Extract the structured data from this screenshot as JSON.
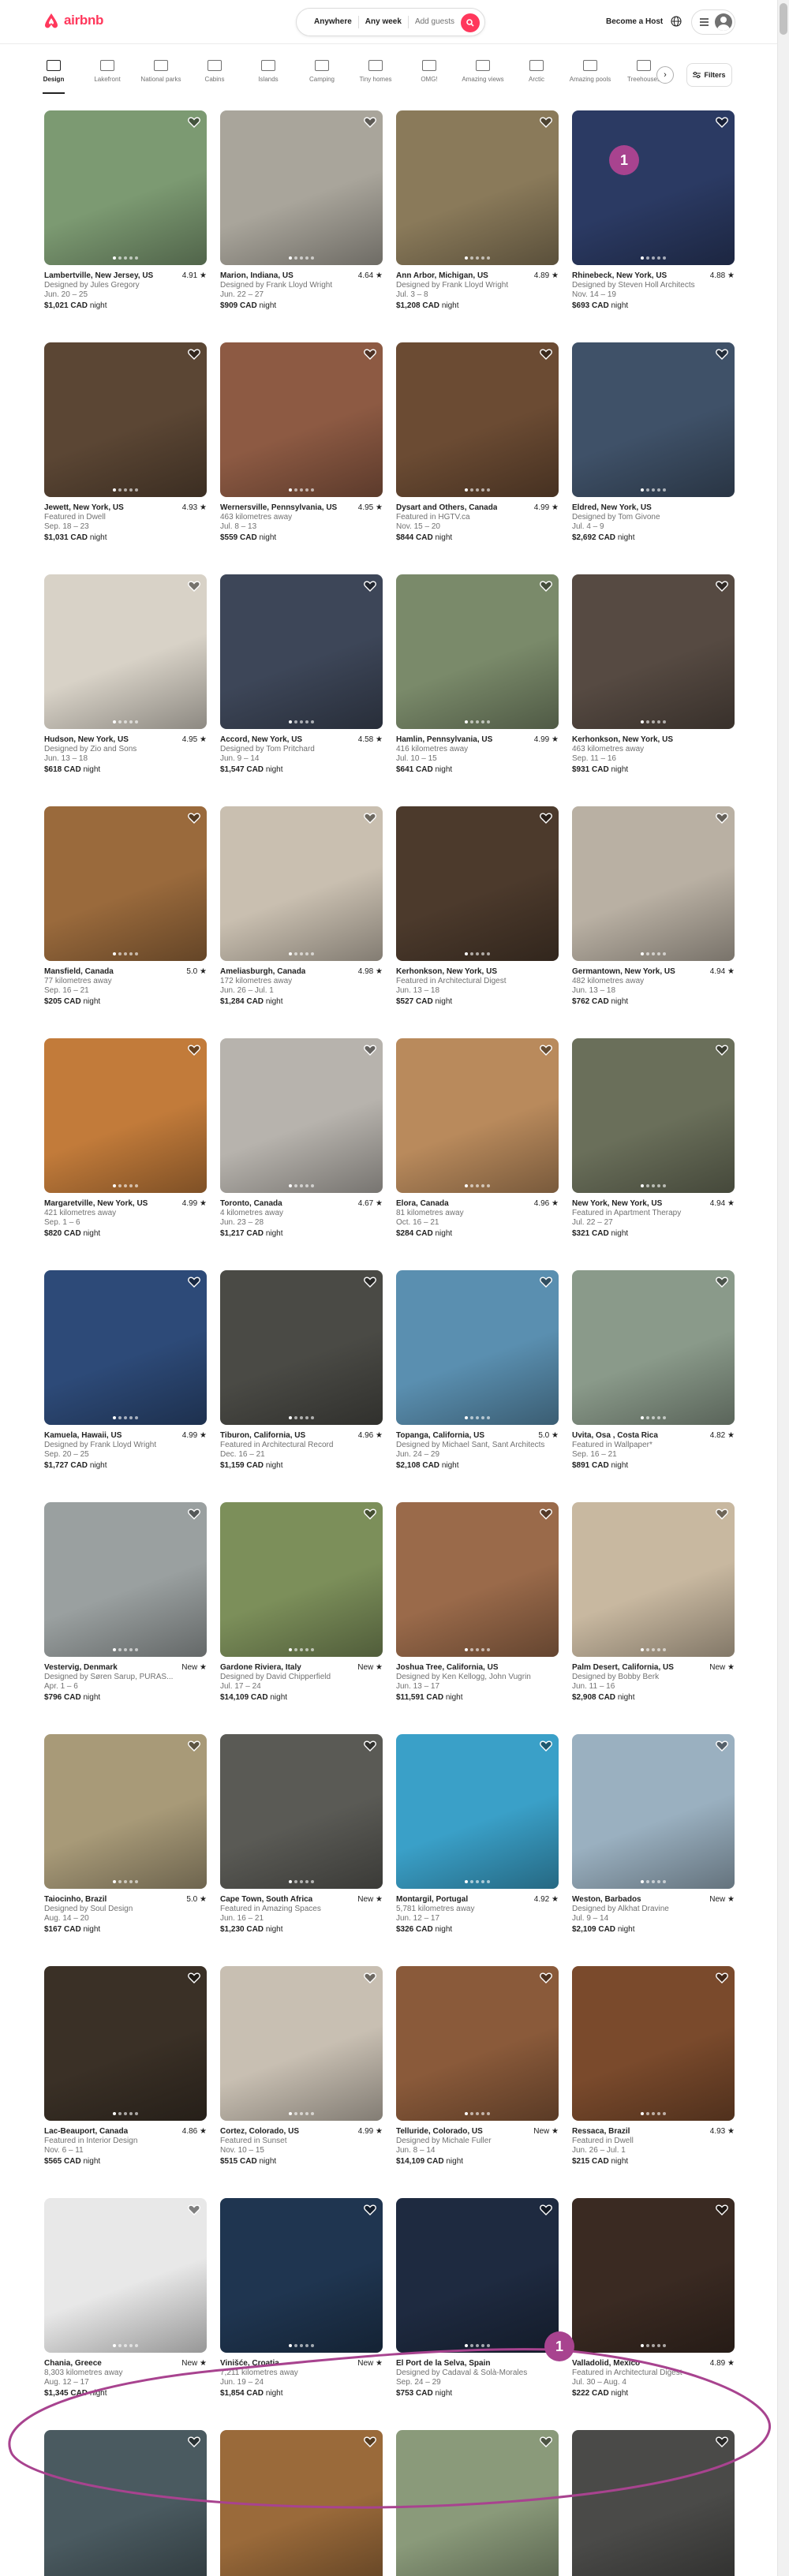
{
  "brand": {
    "name": "airbnb",
    "color": "#ff385c"
  },
  "search": {
    "anywhere": "Anywhere",
    "any_week": "Any week",
    "add_guests": "Add guests"
  },
  "header": {
    "become_host": "Become a Host"
  },
  "categories": [
    {
      "label": "Design",
      "icon": "design-icon",
      "active": true
    },
    {
      "label": "Lakefront",
      "icon": "lakefront-icon"
    },
    {
      "label": "National parks",
      "icon": "national-parks-icon"
    },
    {
      "label": "Cabins",
      "icon": "cabins-icon"
    },
    {
      "label": "Islands",
      "icon": "islands-icon"
    },
    {
      "label": "Camping",
      "icon": "camping-icon"
    },
    {
      "label": "Tiny homes",
      "icon": "tiny-homes-icon"
    },
    {
      "label": "OMG!",
      "icon": "omg-icon"
    },
    {
      "label": "Amazing views",
      "icon": "amazing-views-icon"
    },
    {
      "label": "Arctic",
      "icon": "arctic-icon"
    },
    {
      "label": "Amazing pools",
      "icon": "amazing-pools-icon"
    },
    {
      "label": "Treehouses",
      "icon": "treehouses-icon"
    }
  ],
  "filters_label": "Filters",
  "annotations": [
    "1",
    "1"
  ],
  "listings": [
    {
      "location": "Lambertville, New Jersey, US",
      "rating": "4.91 ★",
      "line2": "Designed by Jules Gregory",
      "dates": "Jun. 20 – 25",
      "price": "$1,021 CAD",
      "unit": "night",
      "color": "#7c9a72"
    },
    {
      "location": "Marion, Indiana, US",
      "rating": "4.64 ★",
      "line2": "Designed by Frank Lloyd Wright",
      "dates": "Jun. 22 – 27",
      "price": "$909 CAD",
      "unit": "night",
      "color": "#a9a59b"
    },
    {
      "location": "Ann Arbor, Michigan, US",
      "rating": "4.89 ★",
      "line2": "Designed by Frank Lloyd Wright",
      "dates": "Jul. 3 – 8",
      "price": "$1,208 CAD",
      "unit": "night",
      "color": "#8a7a5a"
    },
    {
      "location": "Rhinebeck, New York, US",
      "rating": "4.88 ★",
      "line2": "Designed by Steven Holl Architects",
      "dates": "Nov. 14 – 19",
      "price": "$693 CAD",
      "unit": "night",
      "color": "#2b3a63"
    },
    {
      "location": "Jewett, New York, US",
      "rating": "4.93 ★",
      "line2": "Featured in Dwell",
      "dates": "Sep. 18 – 23",
      "price": "$1,031 CAD",
      "unit": "night",
      "color": "#5b4634"
    },
    {
      "location": "Wernersville, Pennsylvania, US",
      "rating": "4.95 ★",
      "line2": "463 kilometres away",
      "dates": "Jul. 8 – 13",
      "price": "$559 CAD",
      "unit": "night",
      "color": "#8d5a43"
    },
    {
      "location": "Dysart and Others, Canada",
      "rating": "4.99 ★",
      "line2": "Featured in HGTV.ca",
      "dates": "Nov. 15 – 20",
      "price": "$844 CAD",
      "unit": "night",
      "color": "#6b4b33"
    },
    {
      "location": "Eldred, New York, US",
      "rating": "",
      "line2": "Designed by Tom Givone",
      "dates": "Jul. 4 – 9",
      "price": "$2,692 CAD",
      "unit": "night",
      "color": "#3f5168"
    },
    {
      "location": "Hudson, New York, US",
      "rating": "4.95 ★",
      "line2": "Designed by Zio and Sons",
      "dates": "Jun. 13 – 18",
      "price": "$618 CAD",
      "unit": "night",
      "color": "#d8d2c7"
    },
    {
      "location": "Accord, New York, US",
      "rating": "4.58 ★",
      "line2": "Designed by Tom Pritchard",
      "dates": "Jun. 9 – 14",
      "price": "$1,547 CAD",
      "unit": "night",
      "color": "#3d4658"
    },
    {
      "location": "Hamlin, Pennsylvania, US",
      "rating": "4.99 ★",
      "line2": "416 kilometres away",
      "dates": "Jul. 10 – 15",
      "price": "$641 CAD",
      "unit": "night",
      "color": "#7a8a6a"
    },
    {
      "location": "Kerhonkson, New York, US",
      "rating": "",
      "line2": "463 kilometres away",
      "dates": "Sep. 11 – 16",
      "price": "$931 CAD",
      "unit": "night",
      "color": "#564a42"
    },
    {
      "location": "Mansfield, Canada",
      "rating": "5.0 ★",
      "line2": "77 kilometres away",
      "dates": "Sep. 16 – 21",
      "price": "$205 CAD",
      "unit": "night",
      "color": "#9a6a3c"
    },
    {
      "location": "Ameliasburgh, Canada",
      "rating": "4.98 ★",
      "line2": "172 kilometres away",
      "dates": "Jun. 26 – Jul. 1",
      "price": "$1,284 CAD",
      "unit": "night",
      "color": "#c9bfb0"
    },
    {
      "location": "Kerhonkson, New York, US",
      "rating": "",
      "line2": "Featured in Architectural Digest",
      "dates": "Jun. 13 – 18",
      "price": "$527 CAD",
      "unit": "night",
      "color": "#4c3a2c"
    },
    {
      "location": "Germantown, New York, US",
      "rating": "4.94 ★",
      "line2": "482 kilometres away",
      "dates": "Jun. 13 – 18",
      "price": "$762 CAD",
      "unit": "night",
      "color": "#b9b0a3"
    },
    {
      "location": "Margaretville, New York, US",
      "rating": "4.99 ★",
      "line2": "421 kilometres away",
      "dates": "Sep. 1 – 6",
      "price": "$820 CAD",
      "unit": "night",
      "color": "#c27b3a"
    },
    {
      "location": "Toronto, Canada",
      "rating": "4.67 ★",
      "line2": "4 kilometres away",
      "dates": "Jun. 23 – 28",
      "price": "$1,217 CAD",
      "unit": "night",
      "color": "#b7b3ad"
    },
    {
      "location": "Elora, Canada",
      "rating": "4.96 ★",
      "line2": "81 kilometres away",
      "dates": "Oct. 16 – 21",
      "price": "$284 CAD",
      "unit": "night",
      "color": "#b98a5c"
    },
    {
      "location": "New York, New York, US",
      "rating": "4.94 ★",
      "line2": "Featured in Apartment Therapy",
      "dates": "Jul. 22 – 27",
      "price": "$321 CAD",
      "unit": "night",
      "color": "#6a6f5a"
    },
    {
      "location": "Kamuela, Hawaii, US",
      "rating": "4.99 ★",
      "line2": "Designed by Frank Lloyd Wright",
      "dates": "Sep. 20 – 25",
      "price": "$1,727 CAD",
      "unit": "night",
      "color": "#2d4a78"
    },
    {
      "location": "Tiburon, California, US",
      "rating": "4.96 ★",
      "line2": "Featured in Architectural Record",
      "dates": "Dec. 16 – 21",
      "price": "$1,159 CAD",
      "unit": "night",
      "color": "#4a4a45"
    },
    {
      "location": "Topanga, California, US",
      "rating": "5.0 ★",
      "line2": "Designed by Michael Sant, Sant Architects",
      "dates": "Jun. 24 – 29",
      "price": "$2,108 CAD",
      "unit": "night",
      "color": "#5a8fb0"
    },
    {
      "location": "Uvita, Osa , Costa Rica",
      "rating": "4.82 ★",
      "line2": "Featured in Wallpaper*",
      "dates": "Sep. 16 – 21",
      "price": "$891 CAD",
      "unit": "night",
      "color": "#8a9a8a"
    },
    {
      "location": "Vestervig, Denmark",
      "rating": "New ★",
      "line2": "Designed by Søren Sarup, PURAS...",
      "dates": "Apr. 1 – 6",
      "price": "$796 CAD",
      "unit": "night",
      "color": "#9aa0a0"
    },
    {
      "location": "Gardone Riviera, Italy",
      "rating": "New ★",
      "line2": "Designed by David Chipperfield",
      "dates": "Jul. 17 – 24",
      "price": "$14,109 CAD",
      "unit": "night",
      "color": "#7c8f5a"
    },
    {
      "location": "Joshua Tree, California, US",
      "rating": "",
      "line2": "Designed by Ken Kellogg, John Vugrin",
      "dates": "Jun. 13 – 17",
      "price": "$11,591 CAD",
      "unit": "night",
      "color": "#9a6a4a"
    },
    {
      "location": "Palm Desert, California, US",
      "rating": "New ★",
      "line2": "Designed by Bobby Berk",
      "dates": "Jun. 11 – 16",
      "price": "$2,908 CAD",
      "unit": "night",
      "color": "#c8b8a0"
    },
    {
      "location": "Taiocinho, Brazil",
      "rating": "5.0 ★",
      "line2": "Designed by Soul Design",
      "dates": "Aug. 14 – 20",
      "price": "$167 CAD",
      "unit": "night",
      "color": "#a89a78"
    },
    {
      "location": "Cape Town, South Africa",
      "rating": "New ★",
      "line2": "Featured in Amazing Spaces",
      "dates": "Jun. 16 – 21",
      "price": "$1,230 CAD",
      "unit": "night",
      "color": "#5a5a55"
    },
    {
      "location": "Montargil, Portugal",
      "rating": "4.92 ★",
      "line2": "5,781 kilometres away",
      "dates": "Jun. 12 – 17",
      "price": "$326 CAD",
      "unit": "night",
      "color": "#3aa0c8"
    },
    {
      "location": "Weston, Barbados",
      "rating": "New ★",
      "line2": "Designed by Alkhat Dravine",
      "dates": "Jul. 9 – 14",
      "price": "$2,109 CAD",
      "unit": "night",
      "color": "#9ab0c0"
    },
    {
      "location": "Lac-Beauport, Canada",
      "rating": "4.86 ★",
      "line2": "Featured in Interior Design",
      "dates": "Nov. 6 – 11",
      "price": "$565 CAD",
      "unit": "night",
      "color": "#3a3026"
    },
    {
      "location": "Cortez, Colorado, US",
      "rating": "4.99 ★",
      "line2": "Featured in Sunset",
      "dates": "Nov. 10 – 15",
      "price": "$515 CAD",
      "unit": "night",
      "color": "#c8bfb2"
    },
    {
      "location": "Telluride, Colorado, US",
      "rating": "New ★",
      "line2": "Designed by Michale Fuller",
      "dates": "Jun. 8 – 14",
      "price": "$14,109 CAD",
      "unit": "night",
      "color": "#8a5a3a"
    },
    {
      "location": "Ressaca, Brazil",
      "rating": "4.93 ★",
      "line2": "Featured in Dwell",
      "dates": "Jun. 26 – Jul. 1",
      "price": "$215 CAD",
      "unit": "night",
      "color": "#7a4a2c"
    },
    {
      "location": "Chania, Greece",
      "rating": "New ★",
      "line2": "8,303 kilometres away",
      "dates": "Aug. 12 – 17",
      "price": "$1,345 CAD",
      "unit": "night",
      "color": "#e8e8e8"
    },
    {
      "location": "Vinišće, Croatia",
      "rating": "New ★",
      "line2": "7,211 kilometres away",
      "dates": "Jun. 19 – 24",
      "price": "$1,854 CAD",
      "unit": "night",
      "color": "#1f3550"
    },
    {
      "location": "El Port de la Selva, Spain",
      "rating": "",
      "line2": "Designed by Cadaval & Solà-Morales",
      "dates": "Sep. 24 – 29",
      "price": "$753 CAD",
      "unit": "night",
      "color": "#1e2a40"
    },
    {
      "location": "Valladolid, Mexico",
      "rating": "4.89 ★",
      "line2": "Featured in Architectural Digest",
      "dates": "Jul. 30 – Aug. 4",
      "price": "$222 CAD",
      "unit": "night",
      "color": "#3a2a22"
    },
    {
      "location": "",
      "rating": "",
      "line2": "",
      "dates": "",
      "price": "",
      "unit": "",
      "color": "#4a5a60"
    },
    {
      "location": "",
      "rating": "",
      "line2": "",
      "dates": "",
      "price": "",
      "unit": "",
      "color": "#9a6a3a"
    },
    {
      "location": "",
      "rating": "",
      "line2": "",
      "dates": "",
      "price": "",
      "unit": "",
      "color": "#8a9a7a"
    },
    {
      "location": "",
      "rating": "",
      "line2": "",
      "dates": "",
      "price": "",
      "unit": "",
      "color": "#4a4a48"
    }
  ]
}
